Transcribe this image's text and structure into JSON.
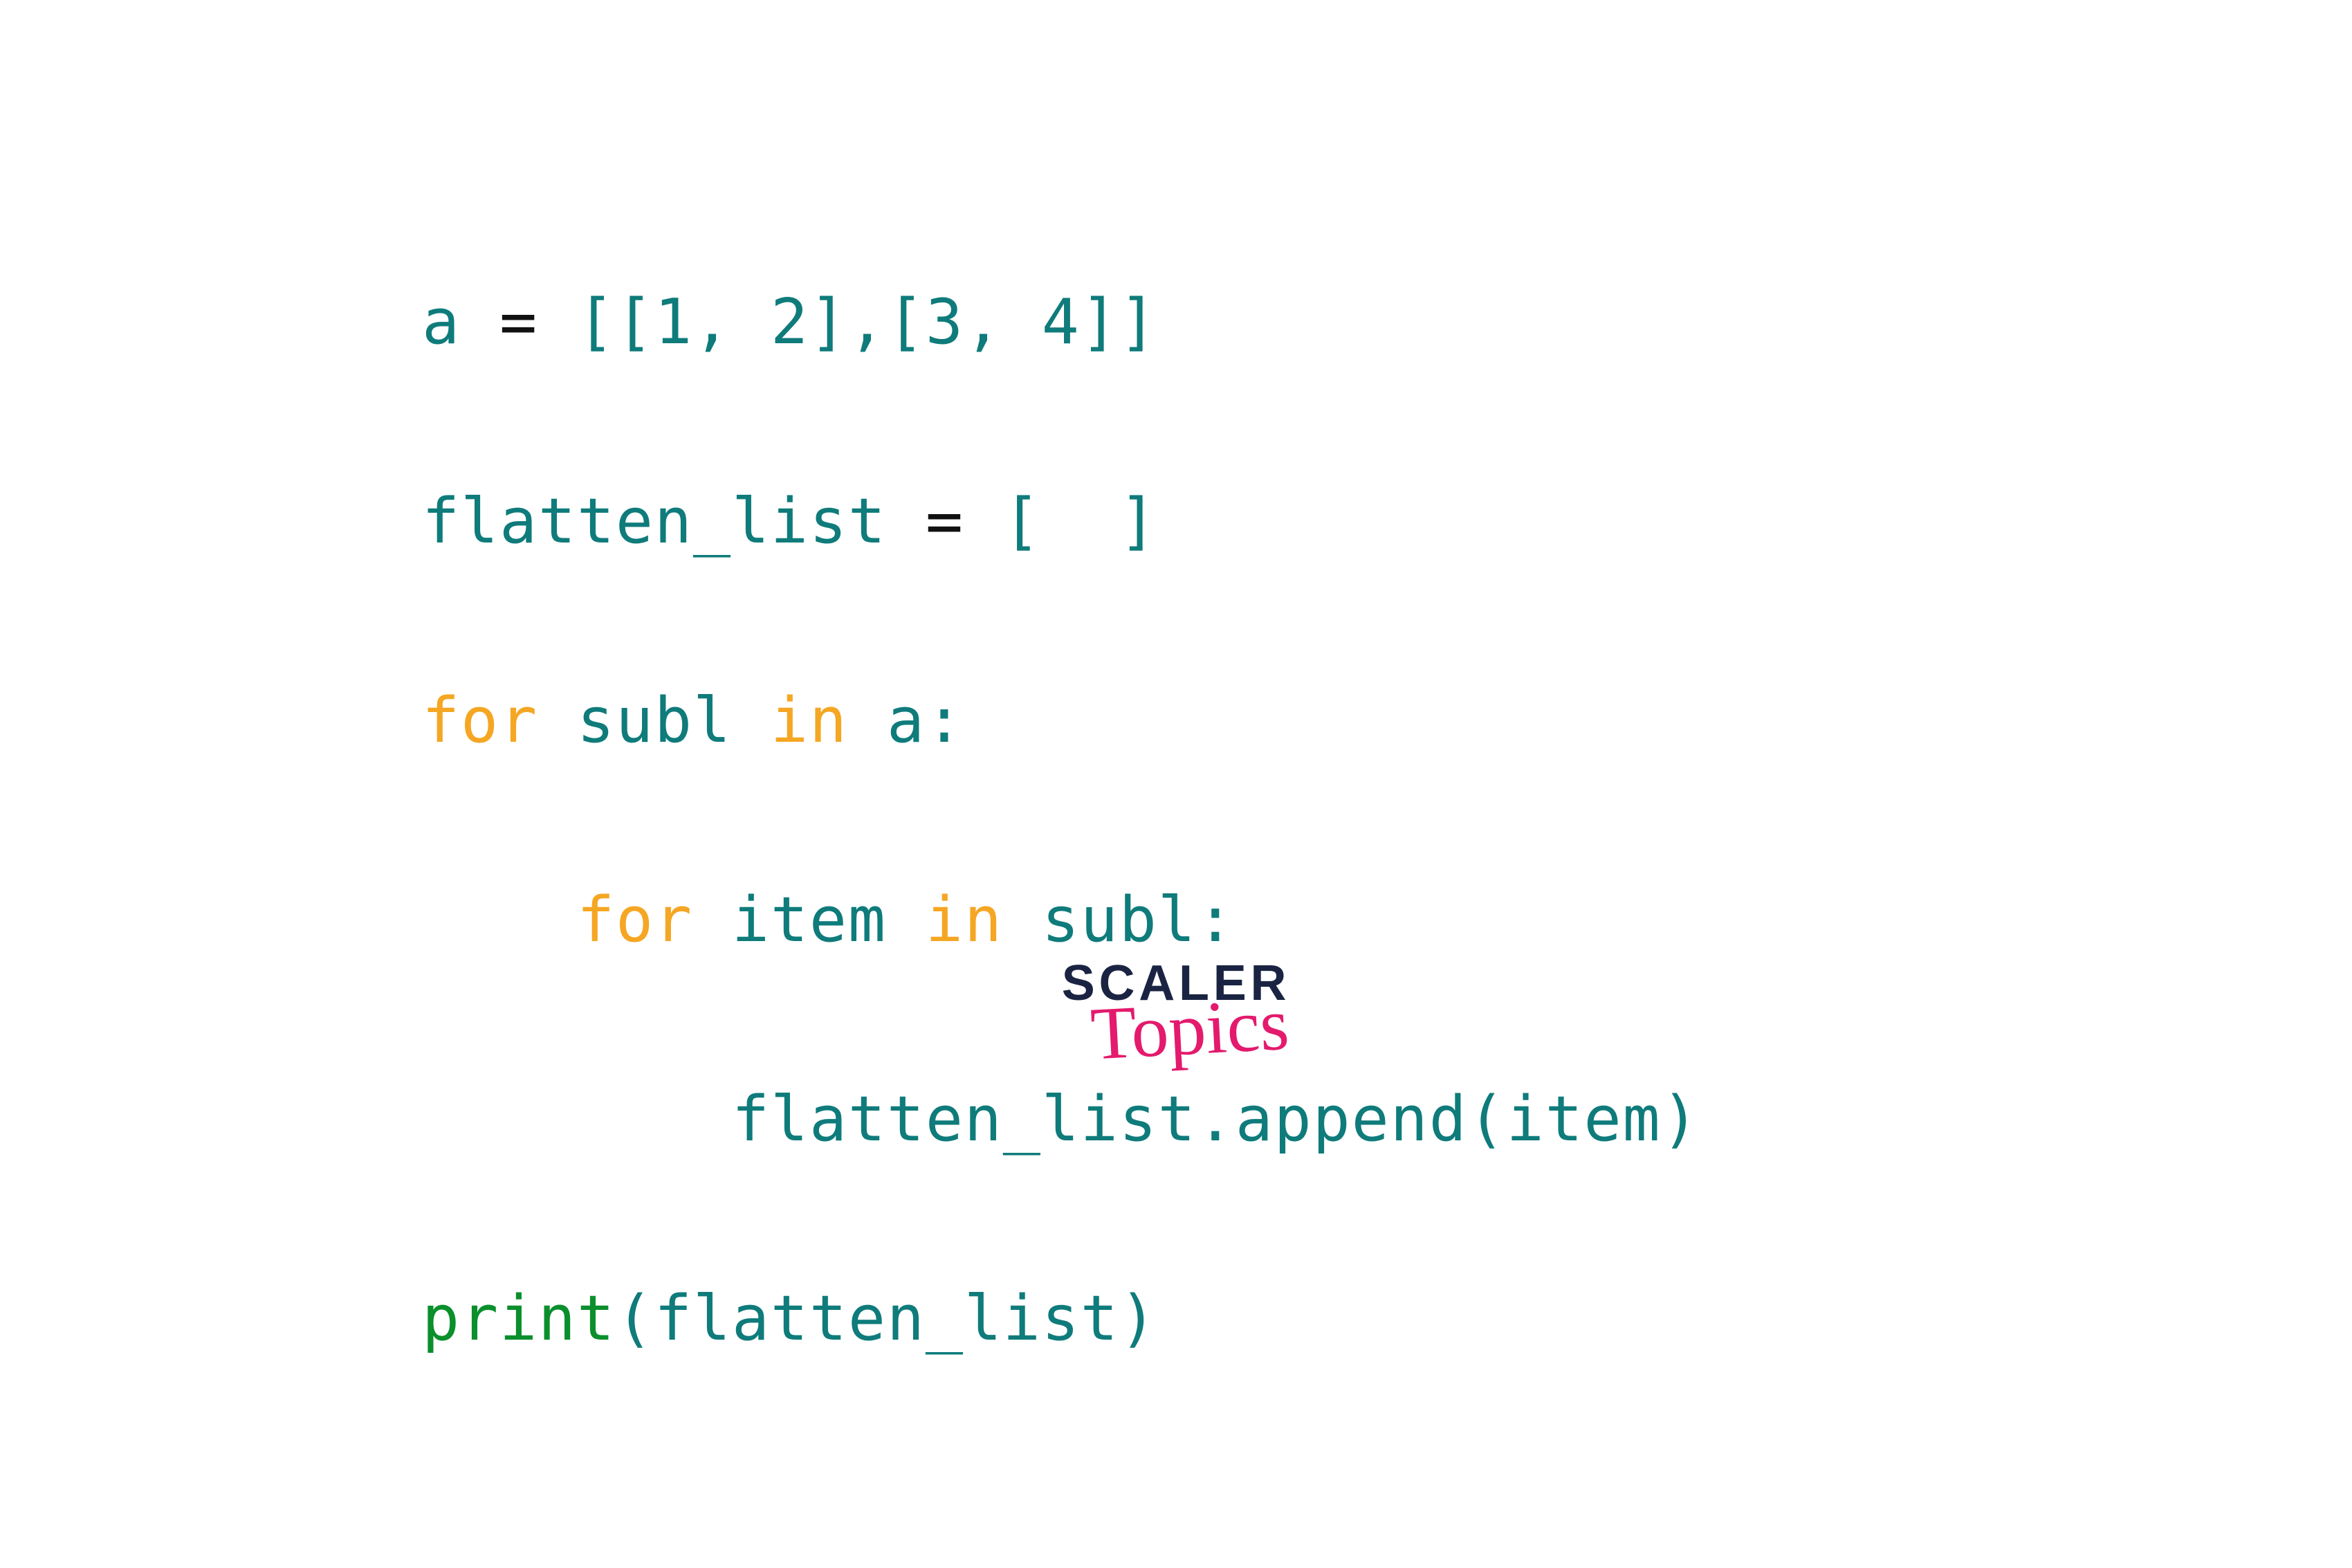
{
  "code": {
    "line1": {
      "a": "a ",
      "eq": "= ",
      "rest": "[[1, 2],[3, 4]]"
    },
    "line2": {
      "a": "flatten_list ",
      "eq": "= ",
      "rest": "[  ]"
    },
    "line3": {
      "for": "for",
      "mid": " subl ",
      "in": "in",
      "rest": " a:"
    },
    "line4": {
      "indent": "    ",
      "for": "for",
      "mid": " item ",
      "in": "in",
      "rest": " subl:"
    },
    "line5": {
      "indent": "        ",
      "body": "flatten_list.append(item)"
    },
    "line6": {
      "fn": "print",
      "rest": "(flatten_list)"
    }
  },
  "logo": {
    "main": "SCALER",
    "sub": "Topics"
  }
}
